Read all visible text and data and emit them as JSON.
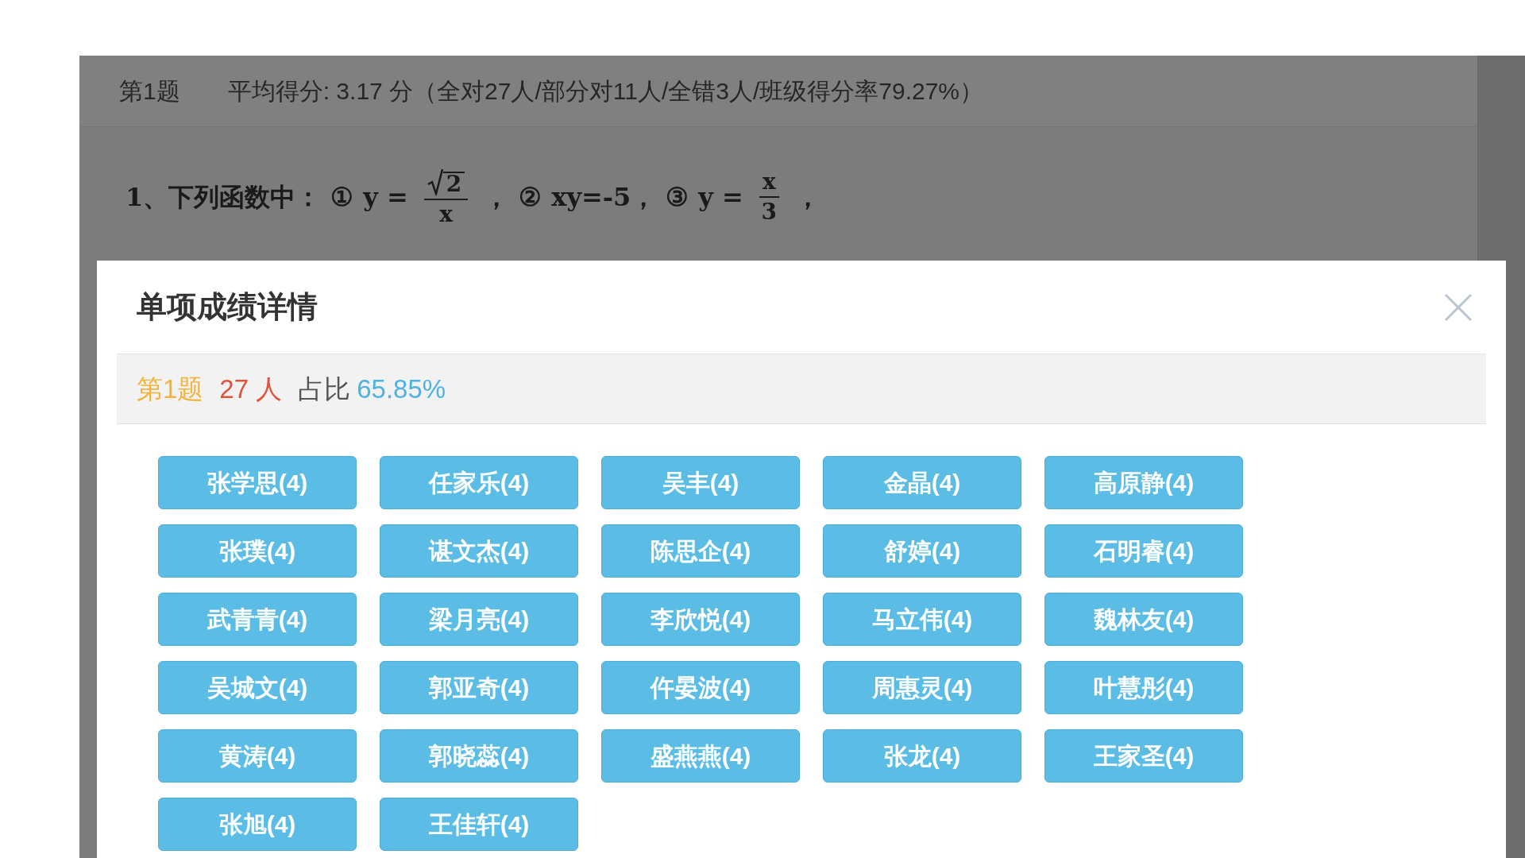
{
  "page_header": {
    "question_label": "第1题",
    "summary": "平均得分: 3.17 分（全对27人/部分对11人/全错3人/班级得分率79.27%）"
  },
  "question": [
    {
      "kind": "text",
      "text": "1、下列函数中："
    },
    {
      "kind": "text",
      "text": "①"
    },
    {
      "kind": "text",
      "text": "y ="
    },
    {
      "kind": "sqrt_fraction",
      "numerator": "2",
      "denominator": "x"
    },
    {
      "kind": "text",
      "text": "，"
    },
    {
      "kind": "text",
      "text": "②"
    },
    {
      "kind": "text",
      "text": "xy=-5，"
    },
    {
      "kind": "text",
      "text": "③"
    },
    {
      "kind": "text",
      "text": "y ="
    },
    {
      "kind": "fraction",
      "numerator": "x",
      "denominator": "3"
    },
    {
      "kind": "text",
      "text": "，"
    }
  ],
  "dialog": {
    "title": "单项成绩详情",
    "summary": {
      "question": "第1题",
      "count": "27 人",
      "ratio_label": "占比",
      "ratio": "65.85%"
    },
    "students": [
      "张学思(4)",
      "任家乐(4)",
      "吴丰(4)",
      "金晶(4)",
      "高原静(4)",
      "张璞(4)",
      "谌文杰(4)",
      "陈思企(4)",
      "舒婷(4)",
      "石明睿(4)",
      "武青青(4)",
      "梁月亮(4)",
      "李欣悦(4)",
      "马立伟(4)",
      "魏林友(4)",
      "吴城文(4)",
      "郭亚奇(4)",
      "仵晏波(4)",
      "周惠灵(4)",
      "叶慧彤(4)",
      "黄涛(4)",
      "郭晓蕊(4)",
      "盛燕燕(4)",
      "张龙(4)",
      "王家圣(4)",
      "张旭(4)",
      "王佳轩(4)"
    ]
  }
}
